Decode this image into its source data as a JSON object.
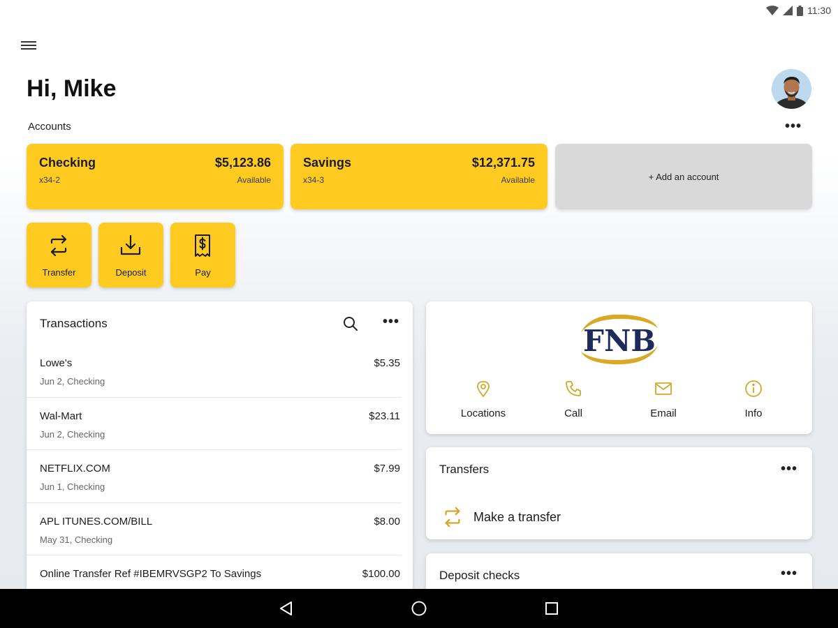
{
  "status_bar": {
    "time": "11:30"
  },
  "header": {
    "greeting": "Hi, Mike"
  },
  "accounts": {
    "label": "Accounts",
    "more": "•••",
    "cards": [
      {
        "name": "Checking",
        "number": "x34-2",
        "balance": "$5,123.86",
        "balance_note": "Available"
      },
      {
        "name": "Savings",
        "number": "x34-3",
        "balance": "$12,371.75",
        "balance_note": "Available"
      }
    ],
    "add_label": "+ Add an account"
  },
  "quick_actions": [
    {
      "label": "Transfer",
      "icon": "transfer-icon"
    },
    {
      "label": "Deposit",
      "icon": "deposit-icon"
    },
    {
      "label": "Pay",
      "icon": "pay-icon"
    }
  ],
  "transactions": {
    "title": "Transactions",
    "more": "•••",
    "items": [
      {
        "name": "Lowe's",
        "meta": "Jun 2, Checking",
        "amount": "$5.35"
      },
      {
        "name": "Wal-Mart",
        "meta": "Jun 2, Checking",
        "amount": "$23.11"
      },
      {
        "name": "NETFLIX.COM",
        "meta": "Jun 1, Checking",
        "amount": "$7.99"
      },
      {
        "name": "APL ITUNES.COM/BILL",
        "meta": "May 31, Checking",
        "amount": "$8.00"
      },
      {
        "name": "Online Transfer Ref #IBEMRVSGP2 To Savings",
        "meta": "",
        "amount": "$100.00"
      }
    ]
  },
  "bank": {
    "logo_text": "FNB",
    "brand_color": "#1d2a5c",
    "accent_color": "#d9a825",
    "contacts": [
      {
        "label": "Locations",
        "icon": "location-pin-icon"
      },
      {
        "label": "Call",
        "icon": "phone-icon"
      },
      {
        "label": "Email",
        "icon": "email-icon"
      },
      {
        "label": "Info",
        "icon": "info-icon"
      }
    ]
  },
  "transfers": {
    "title": "Transfers",
    "more": "•••",
    "action_label": "Make a transfer"
  },
  "deposit_checks": {
    "title": "Deposit checks",
    "more": "•••"
  },
  "colors": {
    "card_yellow": "#ffcb21",
    "icon_gold": "#c9a227",
    "add_card_gray": "#d9d9d9"
  }
}
